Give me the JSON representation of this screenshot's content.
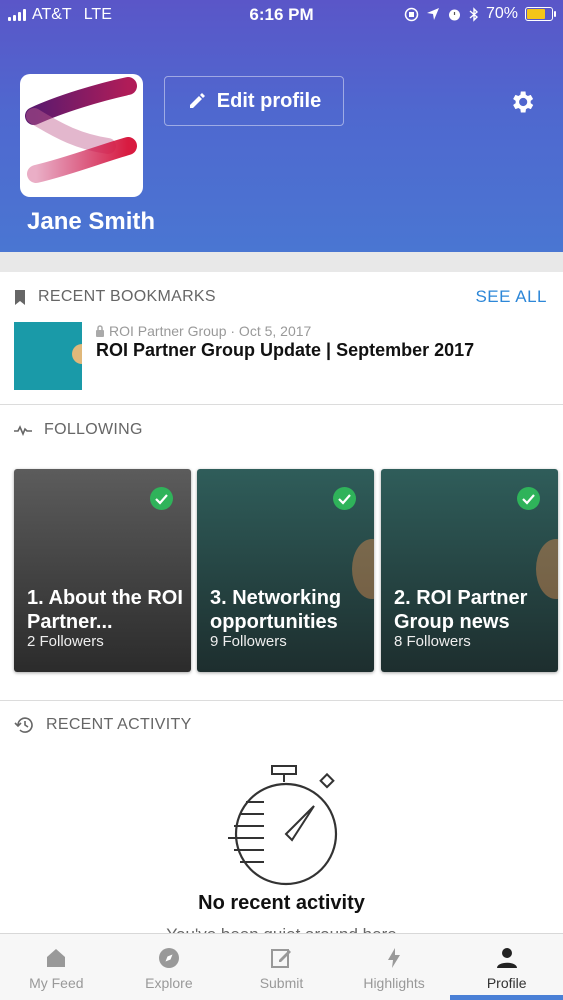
{
  "status_bar": {
    "carrier": "AT&T",
    "network": "LTE",
    "time": "6:16 PM",
    "battery_percent": "70%",
    "battery_level": 0.7
  },
  "profile": {
    "edit_label": "Edit profile",
    "user_name": "Jane Smith"
  },
  "bookmarks": {
    "title": "RECENT BOOKMARKS",
    "see_all": "SEE ALL",
    "items": [
      {
        "meta": "ROI Partner Group · Oct 5, 2017",
        "title": "ROI Partner Group Update | September 2017"
      }
    ]
  },
  "following": {
    "title": "FOLLOWING",
    "cards": [
      {
        "title": "1. About the ROI Partner...",
        "followers": "2 Followers"
      },
      {
        "title": "3. Networking opportunities",
        "followers": "9 Followers"
      },
      {
        "title": "2. ROI Partner Group news",
        "followers": "8 Followers"
      }
    ]
  },
  "activity": {
    "title": "RECENT ACTIVITY",
    "empty_title": "No recent activity",
    "empty_subtitle": "You've been quiet around here"
  },
  "tabs": [
    {
      "label": "My Feed",
      "icon": "home-icon"
    },
    {
      "label": "Explore",
      "icon": "compass-icon"
    },
    {
      "label": "Submit",
      "icon": "edit-icon"
    },
    {
      "label": "Highlights",
      "icon": "bolt-icon"
    },
    {
      "label": "Profile",
      "icon": "person-icon",
      "active": true
    }
  ],
  "colors": {
    "header_top": "#5a56c8",
    "header_bottom": "#4a76d2",
    "accent": "#2d87d8",
    "check": "#2fb35a",
    "tab_indicator": "#4a80d6"
  }
}
